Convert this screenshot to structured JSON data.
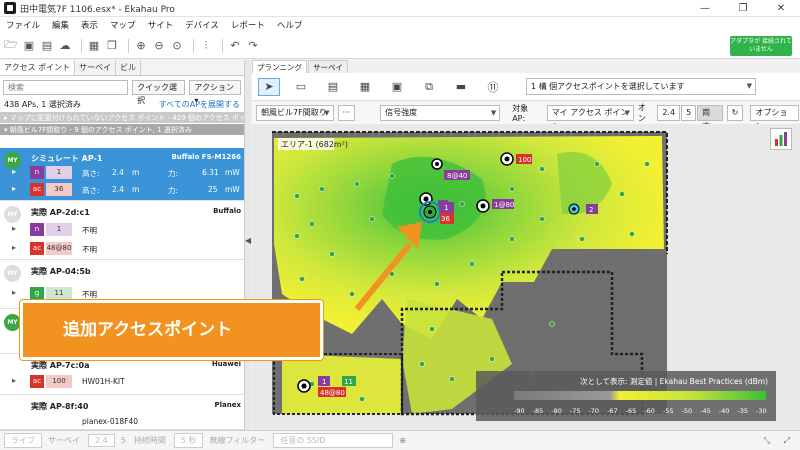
{
  "window": {
    "title": "田中電気7F 1106.esx* - Ekahau Pro",
    "minimize": "—",
    "restore": "❐",
    "close": "✕"
  },
  "menu": [
    "ファイル",
    "編集",
    "表示",
    "マップ",
    "サイト",
    "デバイス",
    "レポート",
    "ヘルプ"
  ],
  "toolbar": {
    "adapter_label": "アダプタが 接続されていません"
  },
  "left": {
    "tabs": [
      "アクセス ポイント",
      "サーベイ",
      "ビル"
    ],
    "search_placeholder": "検索",
    "quick_select": "クイック選択",
    "action": "アクション ▾",
    "summary": "438 APs, 1 選択済み",
    "expand_all": "すべてのAPを展開する",
    "group_unplaced": "▸ マップに配置付けられていないアクセス ポイント - 429 個のアクセス ポイント",
    "group_floor": "▾ 朝風ビル7F間取り - 9 個のアクセス ポイント, 1 選択済み",
    "aps": [
      {
        "my": "MY",
        "name": "シミュレート AP-1",
        "vendor": "Buffalo FS-M1266",
        "n": "1",
        "ac": "36",
        "h1": "高さ:",
        "v1": "2.4",
        "u1": "m",
        "p1": "力:",
        "pv1": "6.31",
        "pu1": "mW",
        "h2": "高さ:",
        "v2": "2.4",
        "u2": "m",
        "p2": "力:",
        "pv2": "25",
        "pu2": "mW"
      },
      {
        "my": "MY",
        "name": "実際 AP-2d:c1",
        "vendor": "Buffalo",
        "n": "1",
        "n_text": "不明",
        "ac": "48@80",
        "ac_text": "不明"
      },
      {
        "my": "MY",
        "name": "実際 AP-04:5b",
        "vendor": "",
        "g": "11",
        "g_text": "不明"
      },
      {
        "name": "実際 AP-7c:0a",
        "vendor": "Huawei",
        "ac": "100",
        "ac_text": "HW01H-KIT"
      },
      {
        "name": "実際 AP-8f:40",
        "vendor": "Planex",
        "extra": "planex-018F40"
      }
    ]
  },
  "right": {
    "tabs": [
      "プランニング",
      "サーベイ"
    ],
    "select_ap": "1 構 個アクセスポイントを選択しています",
    "floor_dd": "朝風ビル7F間取り",
    "more": "···",
    "signal_dd": "信号強度",
    "target_label": "対象 AP:",
    "target_dd": "マイ アクセス ポイント",
    "on_label": "オン",
    "band_24": "2.4",
    "band_5": "5",
    "band_both": "両方",
    "options": "オプション",
    "area_label": "エリア-1 (682m²)",
    "legend_title": "次として表示: 測定値 | Ekahau Best Practices (dBm)",
    "legend_ticks": [
      "-90",
      "-85",
      "-80",
      "-75",
      "-70",
      "-67",
      "-65",
      "-60",
      "-55",
      "-50",
      "-45",
      "-40",
      "-35",
      "-30"
    ]
  },
  "map_badges": {
    "b1": "100",
    "b2": "8@40",
    "b3": "1",
    "b4": "1@80",
    "b5": "1",
    "b6": "36",
    "b7": "2",
    "b8": "1",
    "b9": "11",
    "b10": "48@80"
  },
  "callout": "追加アクセスポイント",
  "bottom": {
    "live": "ライブ",
    "survey": "サーベイ",
    "v24": "2.4",
    "v5": "5",
    "duration_label": "持続時間",
    "duration": "5 秒",
    "wireless_filter": "無線フィルター",
    "filter_value": "任意の SSID"
  }
}
